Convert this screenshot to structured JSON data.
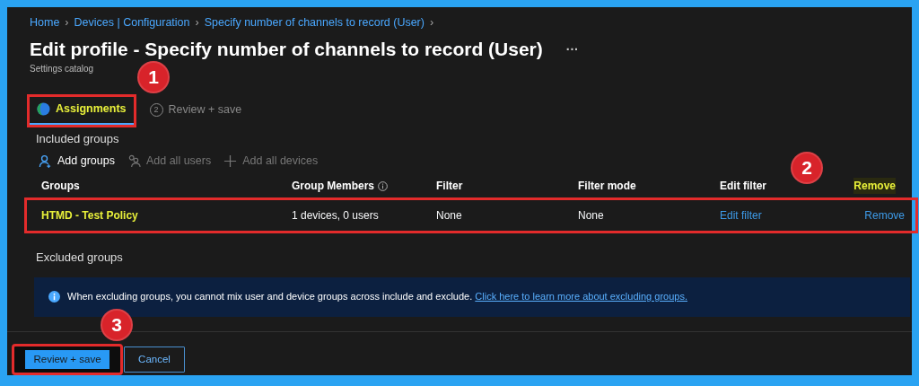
{
  "breadcrumb": [
    "Home",
    "Devices | Configuration",
    "Specify number of channels to record (User)"
  ],
  "breadcrumb_separator": "›",
  "title": "Edit profile - Specify number of channels to record (User)",
  "more": "···",
  "subtitle": "Settings catalog",
  "steps": [
    {
      "label": "Assignments",
      "selected": true,
      "highlighted": true,
      "callout": "1"
    },
    {
      "label": "Review + save",
      "number": "2",
      "selected": false,
      "highlighted": false
    }
  ],
  "included_heading": "Included groups",
  "toolbar": [
    {
      "label": "Add groups",
      "kind": "person",
      "disabled": false
    },
    {
      "label": "Add all users",
      "kind": "people",
      "disabled": true
    },
    {
      "label": "Add all devices",
      "kind": "plus",
      "disabled": true
    }
  ],
  "table": {
    "columns": [
      {
        "label": "Groups",
        "info": false,
        "highlighted": false
      },
      {
        "label": "Group Members",
        "info": true,
        "highlighted": false
      },
      {
        "label": "Filter",
        "info": false,
        "highlighted": false
      },
      {
        "label": "Filter mode",
        "info": false,
        "highlighted": false
      },
      {
        "label": "Edit filter",
        "info": false,
        "highlighted": false
      },
      {
        "label": "Remove",
        "info": false,
        "highlighted": true
      }
    ],
    "callout": "2",
    "rows": [
      {
        "highlighted": true,
        "cells": [
          {
            "text": "HTMD - Test Policy",
            "kind": "name"
          },
          {
            "text": "1 devices, 0 users",
            "kind": "text"
          },
          {
            "text": "None",
            "kind": "text"
          },
          {
            "text": "None",
            "kind": "text"
          },
          {
            "text": "Edit filter",
            "kind": "link"
          },
          {
            "text": "Remove",
            "kind": "link"
          }
        ]
      }
    ]
  },
  "excluded_heading": "Excluded groups",
  "info_bar": {
    "text": "When excluding groups, you cannot mix user and device groups across include and exclude.",
    "link": "Click here to learn more about excluding groups."
  },
  "buttons": [
    {
      "label": "Review + save",
      "kind": "primary",
      "highlighted": true,
      "callout": "3"
    },
    {
      "label": "Cancel",
      "kind": "secondary",
      "highlighted": false
    }
  ]
}
